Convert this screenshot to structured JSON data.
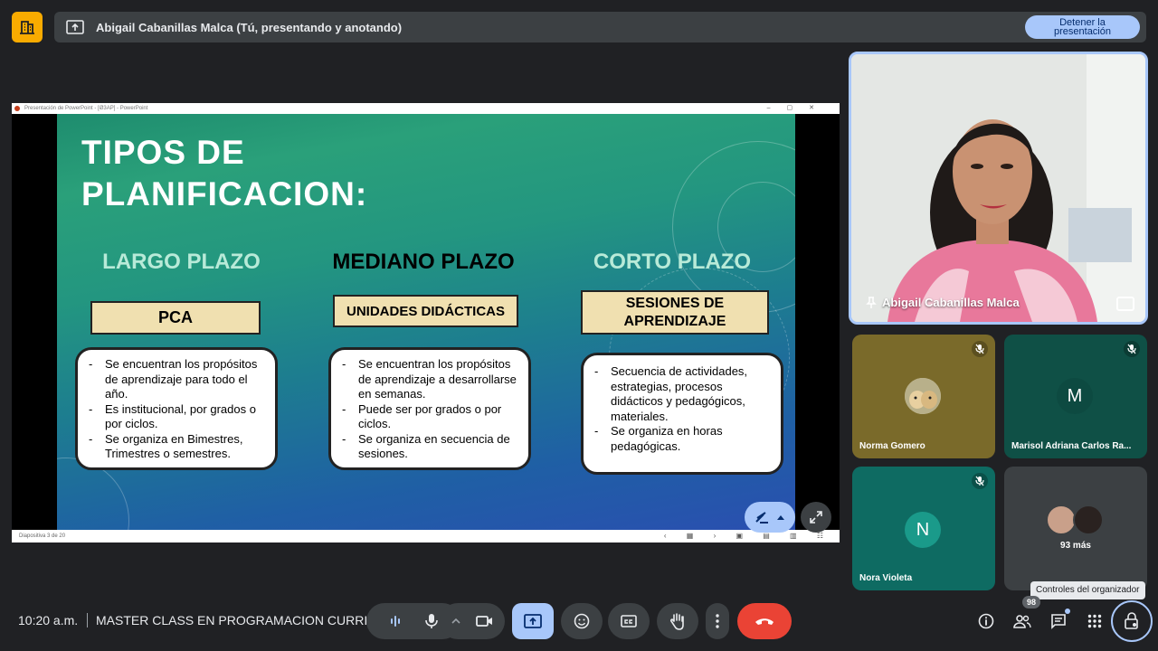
{
  "header": {
    "presenting_text": "Abigail Cabanillas Malca (Tú, presentando y anotando)",
    "stop_button_line1": "Detener la",
    "stop_button_line2": "presentación"
  },
  "ppt": {
    "window_title": "Presentación de PowerPoint - [Ø3AP] - PowerPoint",
    "status": "Diapositiva 3 de 20"
  },
  "slide": {
    "title_line1": "TIPOS DE",
    "title_line2": "PLANIFICACION:",
    "columns": [
      {
        "heading": "LARGO PLAZO",
        "label": "PCA",
        "items": [
          "Se encuentran los propósitos de aprendizaje para todo el año.",
          "Es institucional, por grados o por ciclos.",
          "Se organiza en  Bimestres, Trimestres o semestres."
        ]
      },
      {
        "heading": "MEDIANO PLAZO",
        "label": "UNIDADES DIDÁCTICAS",
        "items": [
          "Se encuentran los propósitos de aprendizaje a desarrollarse en semanas.",
          "Puede ser por grados o por ciclos.",
          "Se organiza en  secuencia de sesiones."
        ]
      },
      {
        "heading": "CORTO PLAZO",
        "label_line1": "SESIONES DE",
        "label_line2": "APRENDIZAJE",
        "items": [
          "Secuencia de actividades, estrategias, procesos didácticos y pedagógicos, materiales.",
          "Se organiza en horas pedagógicas."
        ]
      }
    ]
  },
  "participants": {
    "main": {
      "name": "Abigail Cabanillas Malca"
    },
    "tiles": [
      {
        "name": "Norma Gomero"
      },
      {
        "name": "Marisol Adriana Carlos Ra...",
        "initial": "M"
      },
      {
        "name": "Nora Violeta",
        "initial": "N"
      }
    ],
    "more": "93 más"
  },
  "tooltip": "Controles del organizador",
  "bottom": {
    "time": "10:20 a.m.",
    "meeting_title": "MASTER CLASS EN PROGRAMACION CURRI...",
    "people_count": "98"
  },
  "colors": {
    "accent_blue": "#a8c7fa",
    "end_call_red": "#ea4335",
    "logo_yellow": "#f9ab00",
    "heading_green": "#b8ead8"
  }
}
